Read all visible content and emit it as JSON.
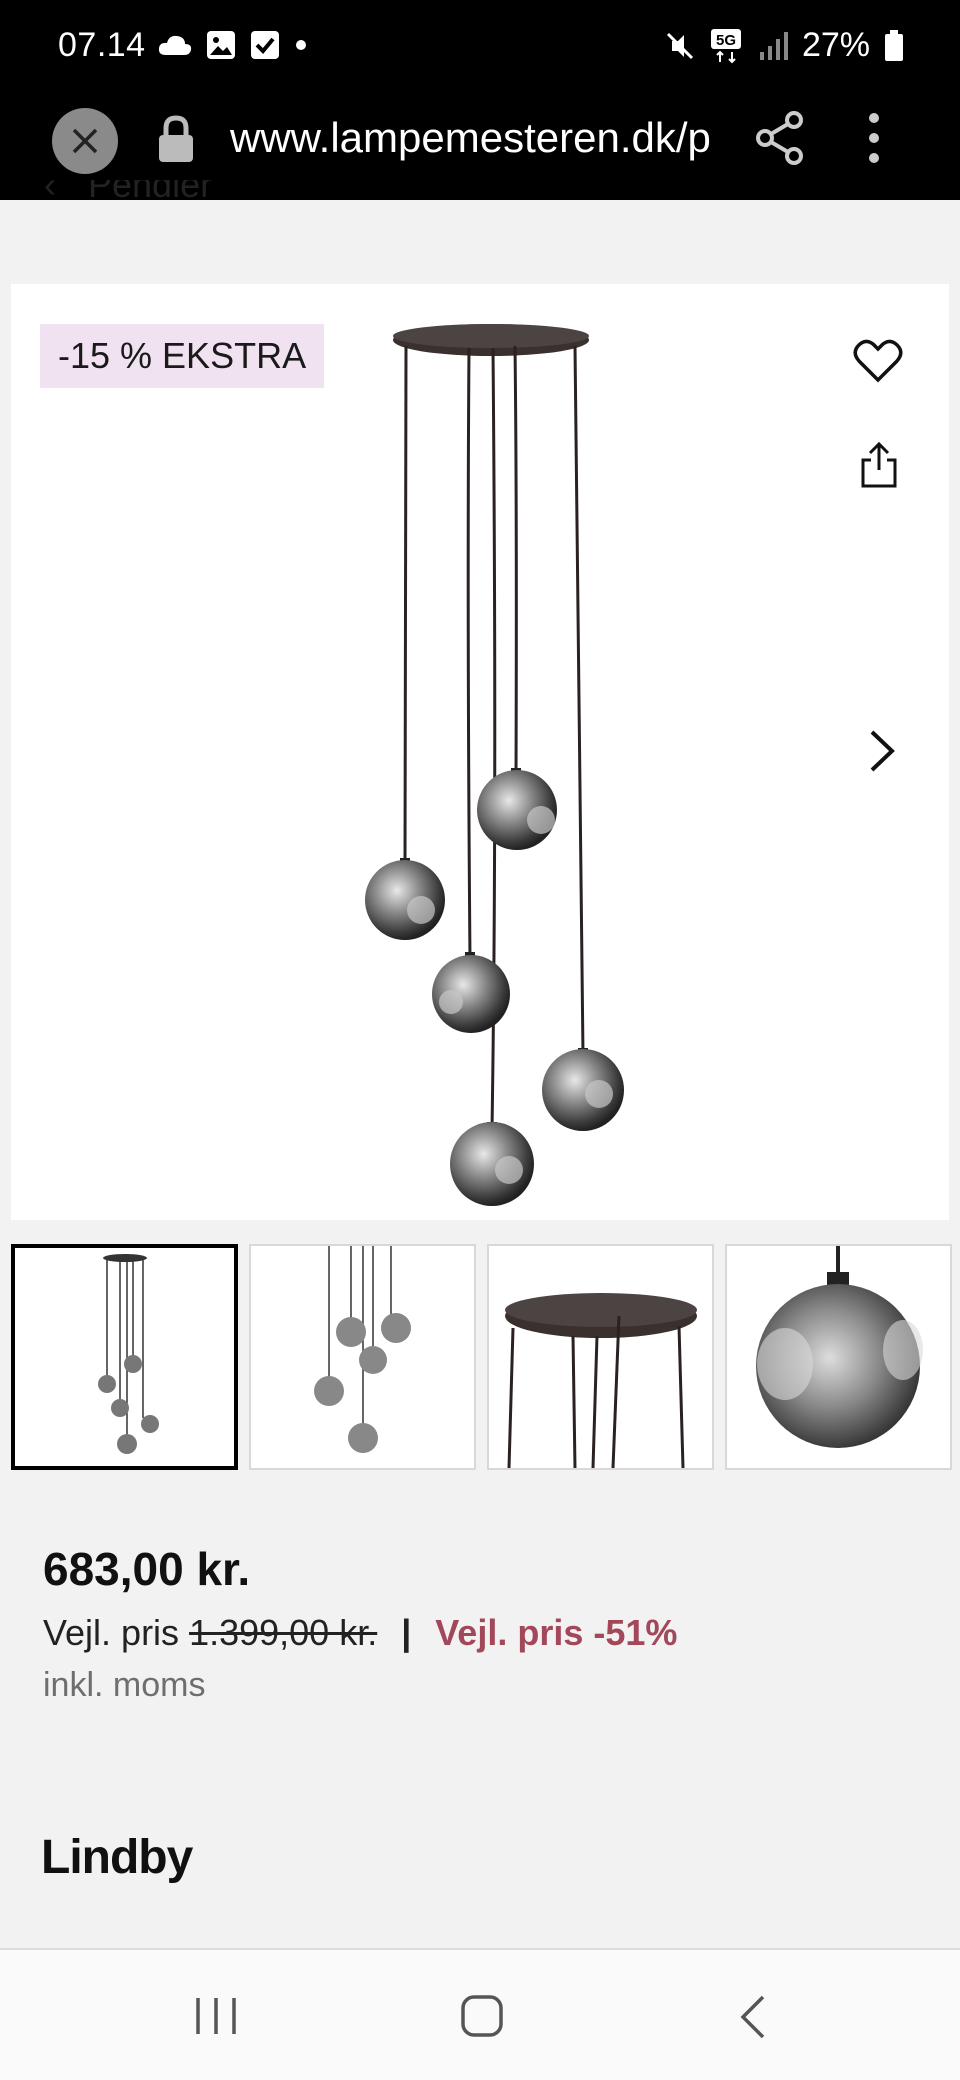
{
  "status_bar": {
    "time": "07.14",
    "battery": "27%",
    "network": "5G"
  },
  "browser": {
    "url": "www.lampemesteren.dk/p"
  },
  "breadcrumb": {
    "back_glyph": "‹",
    "label": "Pendler"
  },
  "product": {
    "badge": "-15 % EKSTRA",
    "price": "683,00 kr.",
    "rrp_label": "Vejl. pris",
    "rrp_value": "1.399,00 kr.",
    "separator": "|",
    "discount_label": "Vejl. pris -51%",
    "vat_note": "inkl. moms",
    "brand": "Lindby"
  },
  "icons": {
    "close": "close-icon",
    "lock": "lock-icon",
    "share": "share-icon",
    "more": "more-vertical-icon",
    "favorite": "heart-icon",
    "export": "export-icon",
    "next": "chevron-right-icon"
  },
  "colors": {
    "badge_bg": "#f1e2f2",
    "discount": "#a3475a",
    "status_bar": "#000000"
  }
}
